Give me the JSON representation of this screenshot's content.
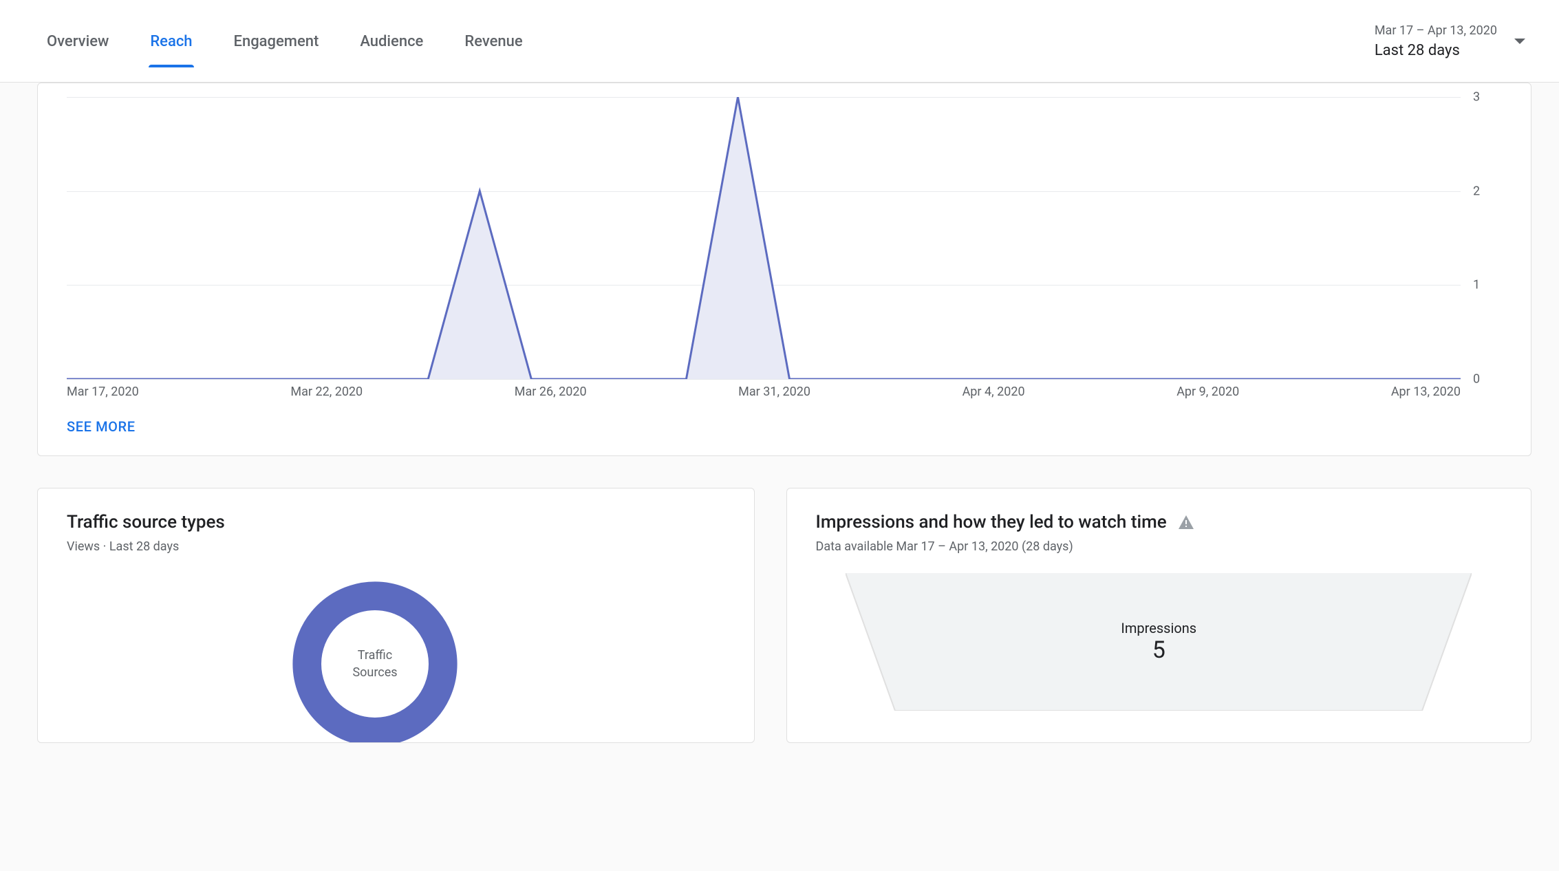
{
  "header": {
    "tabs": [
      {
        "label": "Overview",
        "active": false
      },
      {
        "label": "Reach",
        "active": true
      },
      {
        "label": "Engagement",
        "active": false
      },
      {
        "label": "Audience",
        "active": false
      },
      {
        "label": "Revenue",
        "active": false
      }
    ],
    "date_picker": {
      "range": "Mar 17 – Apr 13, 2020",
      "label": "Last 28 days"
    }
  },
  "chart_data": {
    "type": "area",
    "title": "",
    "xlabel": "",
    "ylabel": "",
    "ylim": [
      0,
      3
    ],
    "y_ticks": [
      0,
      1,
      2,
      3
    ],
    "x_tick_labels": [
      "Mar 17, 2020",
      "Mar 22, 2020",
      "Mar 26, 2020",
      "Mar 31, 2020",
      "Apr 4, 2020",
      "Apr 9, 2020",
      "Apr 13, 2020"
    ],
    "series": [
      {
        "name": "Impressions",
        "x": [
          "Mar 17",
          "Mar 18",
          "Mar 19",
          "Mar 20",
          "Mar 21",
          "Mar 22",
          "Mar 23",
          "Mar 24",
          "Mar 25",
          "Mar 26",
          "Mar 27",
          "Mar 28",
          "Mar 29",
          "Mar 30",
          "Mar 31",
          "Apr 1",
          "Apr 2",
          "Apr 3",
          "Apr 4",
          "Apr 5",
          "Apr 6",
          "Apr 7",
          "Apr 8",
          "Apr 9",
          "Apr 10",
          "Apr 11",
          "Apr 12",
          "Apr 13"
        ],
        "values": [
          0,
          0,
          0,
          0,
          0,
          0,
          0,
          0,
          2,
          0,
          0,
          0,
          0,
          3,
          0,
          0,
          0,
          0,
          0,
          0,
          0,
          0,
          0,
          0,
          0,
          0,
          0,
          0
        ]
      }
    ],
    "color": "#5c6bc0",
    "fill": "#e8eaf6"
  },
  "main_chart": {
    "see_more": "SEE MORE"
  },
  "traffic_card": {
    "title": "Traffic source types",
    "subtitle": "Views · Last 28 days",
    "donut_label_line1": "Traffic",
    "donut_label_line2": "Sources",
    "color": "#5c6bc0"
  },
  "impressions_card": {
    "title": "Impressions and how they led to watch time",
    "subtitle": "Data available Mar 17 – Apr 13, 2020 (28 days)",
    "funnel_stage_label": "Impressions",
    "funnel_stage_value": "5",
    "trapezoid_fill": "#f1f3f4",
    "trapezoid_stroke": "#e0e0e0"
  }
}
